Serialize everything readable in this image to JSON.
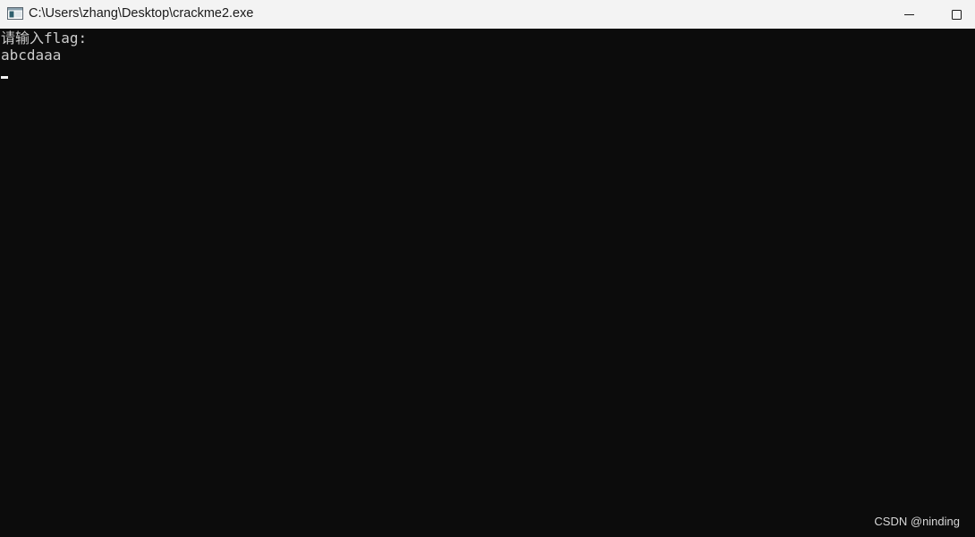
{
  "window": {
    "title": "C:\\Users\\zhang\\Desktop\\crackme2.exe",
    "icon": "console-app-icon",
    "controls": {
      "minimize_icon": "minimize-icon",
      "maximize_icon": "maximize-icon"
    }
  },
  "console": {
    "lines": [
      "请输入flag:",
      "abcdaaa"
    ],
    "background": "#0c0c0c",
    "foreground": "#cccccc"
  },
  "watermark": "CSDN @ninding"
}
